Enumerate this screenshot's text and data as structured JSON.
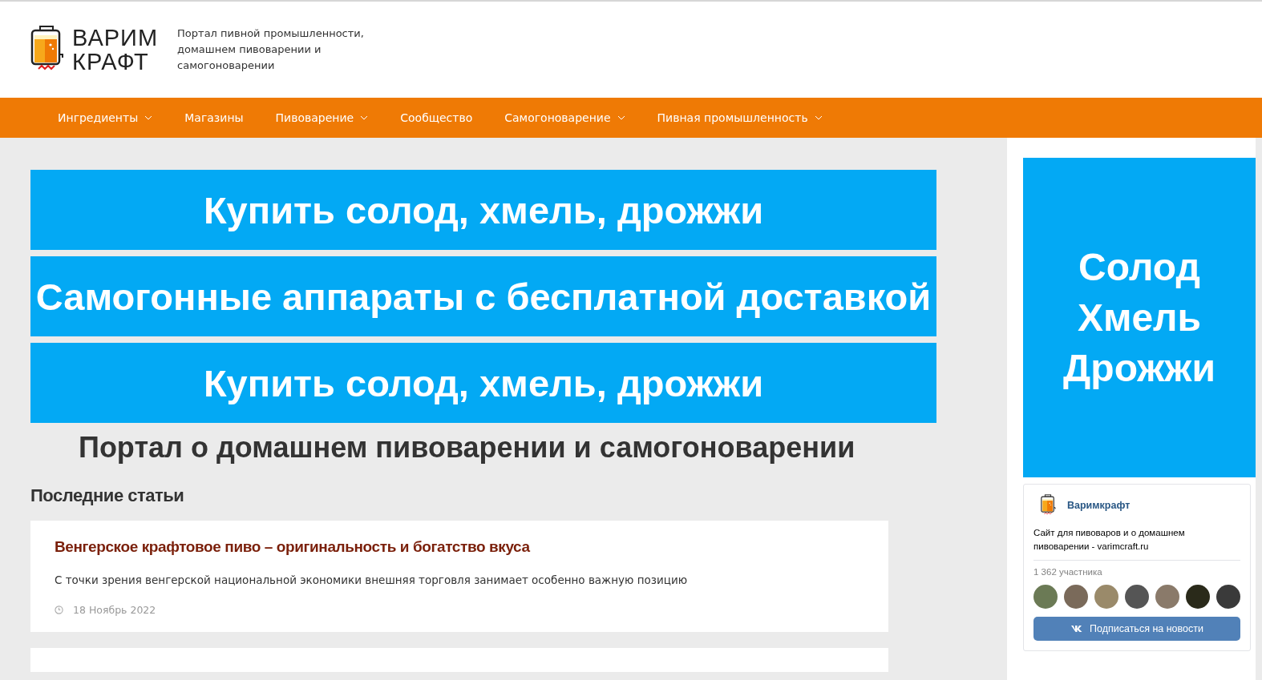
{
  "header": {
    "logo_text": [
      "ВАРИМ",
      "КРАФТ"
    ],
    "tagline": "Портал пивной промышленности, домашнем пивоварении и самогоноварении"
  },
  "nav": [
    {
      "label": "Ингредиенты",
      "dropdown": true
    },
    {
      "label": "Магазины",
      "dropdown": false
    },
    {
      "label": "Пивоварение",
      "dropdown": true
    },
    {
      "label": "Сообщество",
      "dropdown": false
    },
    {
      "label": "Самогоноварение",
      "dropdown": true
    },
    {
      "label": "Пивная промышленность",
      "dropdown": true
    }
  ],
  "banners": [
    "Купить солод, хмель, дрожжи",
    "Самогонные аппараты с бесплатной доставкой",
    "Купить солод, хмель, дрожжи"
  ],
  "page_title": "Портал о домашнем пивоварении и самогоноварении",
  "section_title": "Последние статьи",
  "articles": [
    {
      "title": "Венгерское крафтовое пиво – оригинальность и богатство вкуса",
      "excerpt": "С точки зрения венгерской национальной экономики внешняя торговля занимает особенно важную позицию",
      "date": "18 Ноябрь 2022"
    }
  ],
  "sidebar": {
    "banner_lines": [
      "Солод",
      "Хмель",
      "Дрожжи"
    ],
    "vk_widget": {
      "name": "Варимкрафт",
      "description": "Сайт для пивоваров и о домашнем пивоварении - varimcraft.ru",
      "members": "1 362 участника",
      "button": "Подписаться на новости"
    }
  }
}
